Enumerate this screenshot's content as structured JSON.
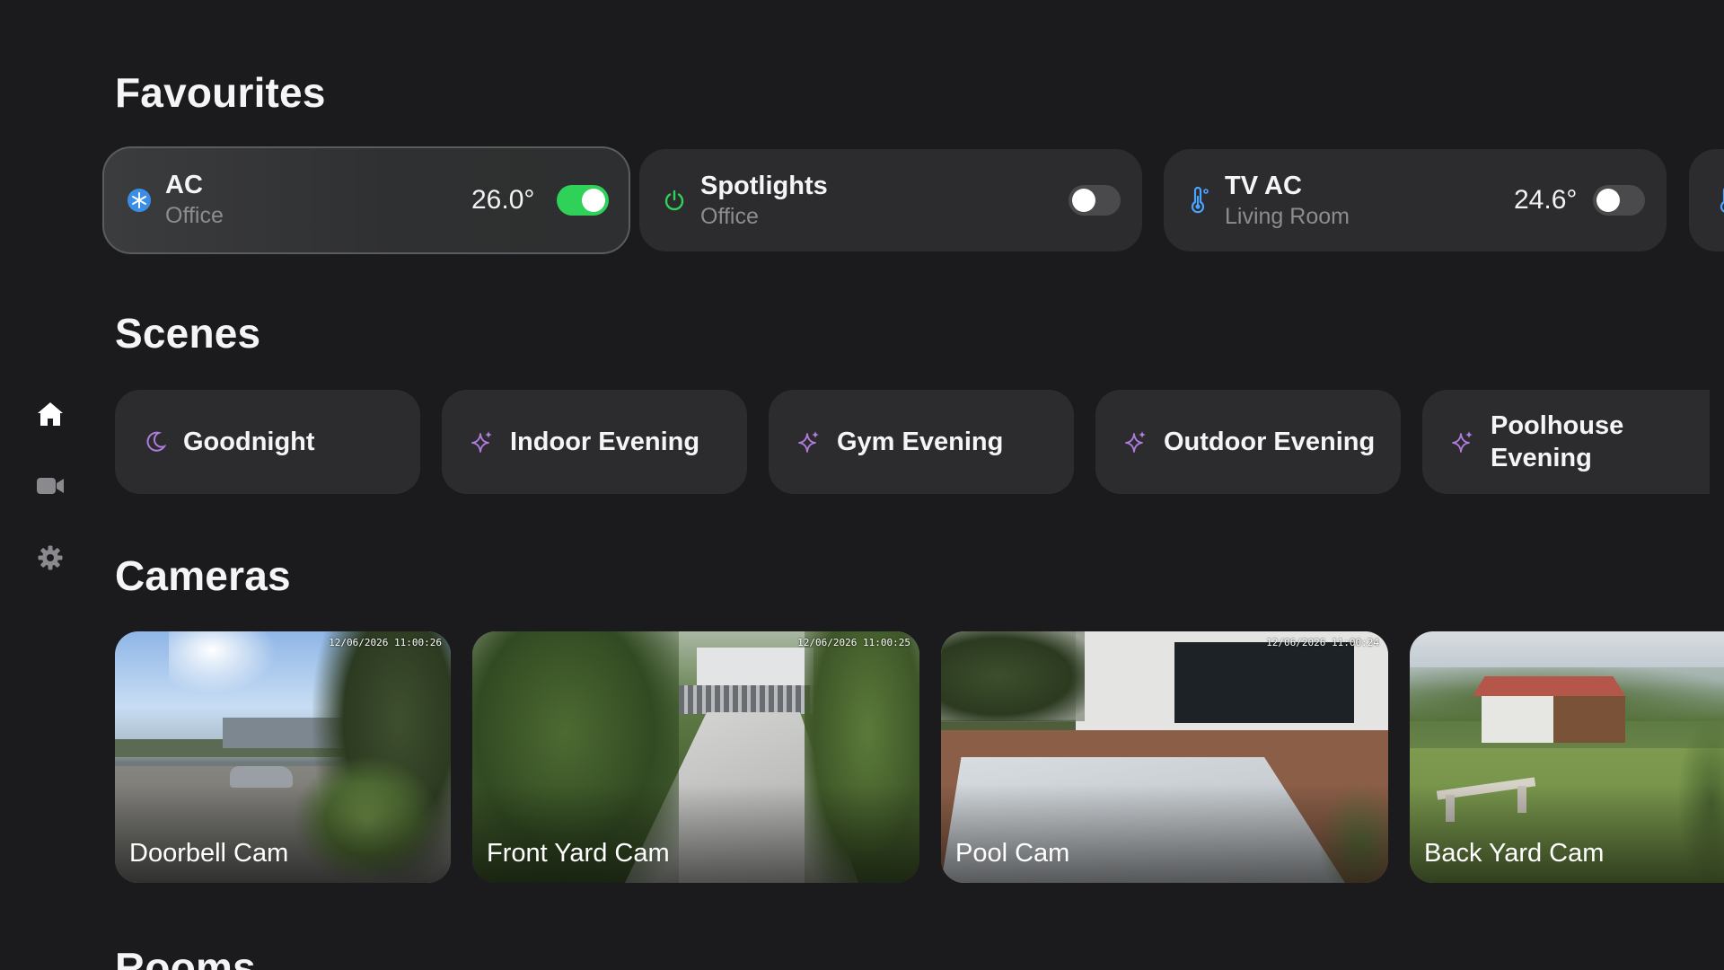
{
  "sections": {
    "favourites": "Favourites",
    "scenes": "Scenes",
    "cameras": "Cameras",
    "rooms": "Rooms"
  },
  "nav": {
    "items": [
      {
        "icon": "home-icon",
        "active": true
      },
      {
        "icon": "video-camera-icon",
        "active": false
      },
      {
        "icon": "gear-icon",
        "active": false
      }
    ]
  },
  "favourites": [
    {
      "name": "AC",
      "room": "Office",
      "value": "26.0°",
      "on": true,
      "icon": "snowflake-icon",
      "accent": "#4aa3ff"
    },
    {
      "name": "Spotlights",
      "room": "Office",
      "value": "",
      "on": false,
      "icon": "power-icon",
      "accent": "#30d158"
    },
    {
      "name": "TV AC",
      "room": "Living Room",
      "value": "24.6°",
      "on": false,
      "icon": "thermometer-icon",
      "accent": "#4aa3ff"
    }
  ],
  "scenes": [
    {
      "label": "Goodnight",
      "icon": "moon-icon"
    },
    {
      "label": "Indoor Evening",
      "icon": "sparkle-icon"
    },
    {
      "label": "Gym Evening",
      "icon": "sparkle-icon"
    },
    {
      "label": "Outdoor Evening",
      "icon": "sparkle-icon"
    },
    {
      "label": "Poolhouse Evening",
      "icon": "sparkle-icon"
    }
  ],
  "cameras": [
    {
      "label": "Doorbell Cam",
      "timestamp": "12/06/2026 11:00:26"
    },
    {
      "label": "Front Yard Cam",
      "timestamp": "12/06/2026 11:00:25"
    },
    {
      "label": "Pool Cam",
      "timestamp": "12/06/2026 11:00:24"
    },
    {
      "label": "Back Yard Cam",
      "timestamp": ""
    }
  ],
  "colors": {
    "background": "#1b1b1d",
    "card": "#2c2c2e",
    "toggle_on": "#30d158",
    "toggle_off": "#4a4a4d",
    "scene_icon": "#b07ce0",
    "secondary_text": "#8c8c91"
  }
}
